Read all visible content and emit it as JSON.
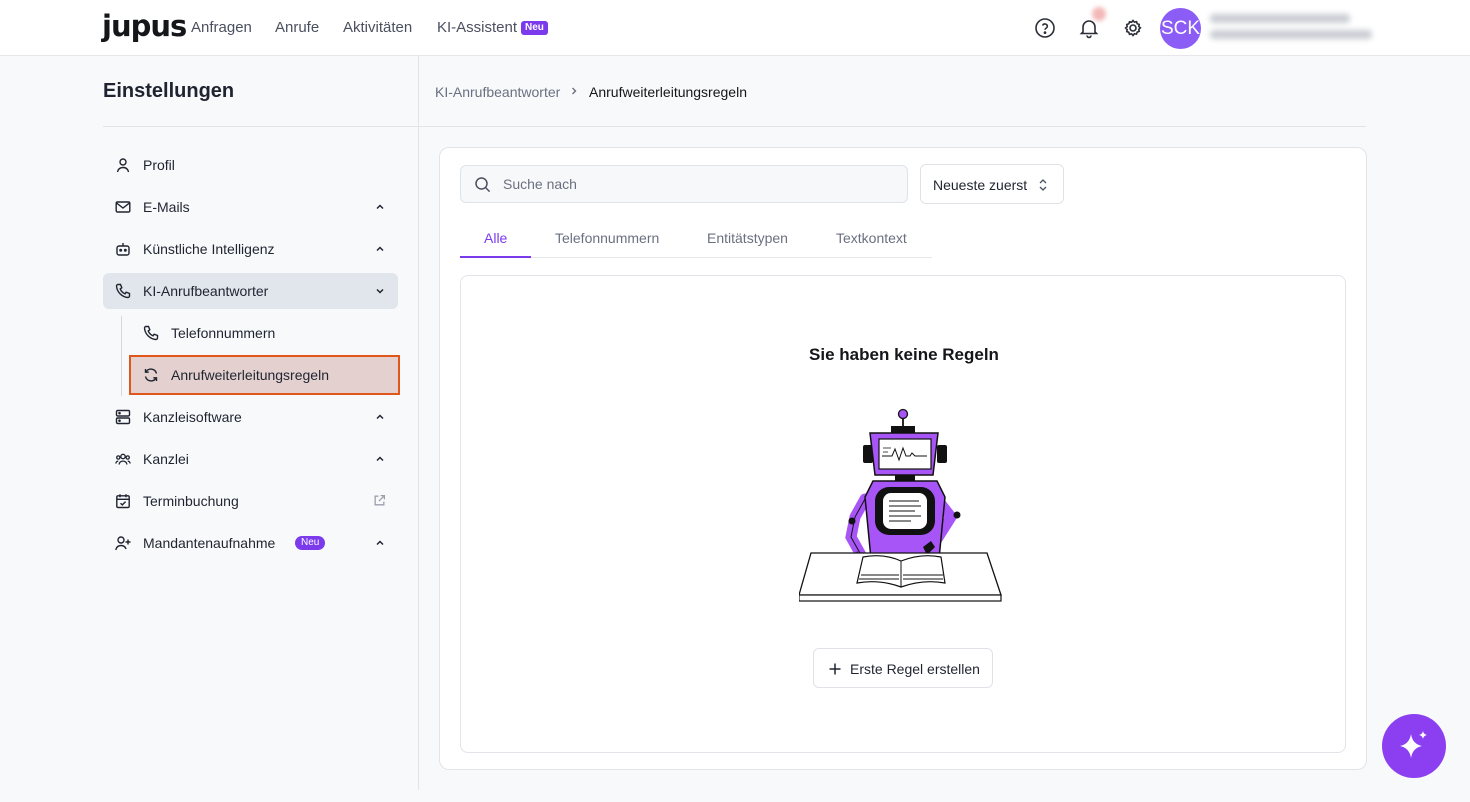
{
  "topbar": {
    "logo": "jupus",
    "nav": [
      "Anfragen",
      "Anrufe",
      "Aktivitäten",
      "KI-Assistent"
    ],
    "nav_badge": "Neu",
    "avatar_initials": "SCK",
    "icons": [
      "help-circle-icon",
      "bell-icon",
      "gear-icon"
    ]
  },
  "sidebar": {
    "title": "Einstellungen",
    "items": [
      {
        "label": "Profil",
        "icon": "user-icon"
      },
      {
        "label": "E-Mails",
        "icon": "mail-icon"
      },
      {
        "label": "Künstliche Intelligenz",
        "icon": "bot-icon"
      },
      {
        "label": "KI-Anrufbeantworter",
        "icon": "phone-icon"
      },
      {
        "label": "Kanzleisoftware",
        "icon": "server-icon"
      },
      {
        "label": "Kanzlei",
        "icon": "users-icon"
      },
      {
        "label": "Terminbuchung",
        "icon": "calendar-check-icon"
      },
      {
        "label": "Mandantenaufnahme",
        "icon": "user-plus-icon",
        "badge": "Neu"
      }
    ],
    "sub_items": [
      {
        "label": "Telefonnummern",
        "icon": "phone-icon"
      },
      {
        "label": "Anrufweiterleitungsregeln",
        "icon": "refresh-icon"
      }
    ]
  },
  "breadcrumb": {
    "parent": "KI-Anrufbeantworter",
    "current": "Anrufweiterleitungsregeln"
  },
  "main": {
    "search_placeholder": "Suche nach",
    "sort_label": "Neueste zuerst",
    "tabs": [
      "Alle",
      "Telefonnummern",
      "Entitätstypen",
      "Textkontext"
    ],
    "empty_title": "Sie haben keine Regeln",
    "create_button": "Erste Regel erstellen"
  },
  "colors": {
    "accent": "#7c3aed",
    "selected_border": "#e0561b",
    "selected_bg": "#e3d0cf"
  }
}
